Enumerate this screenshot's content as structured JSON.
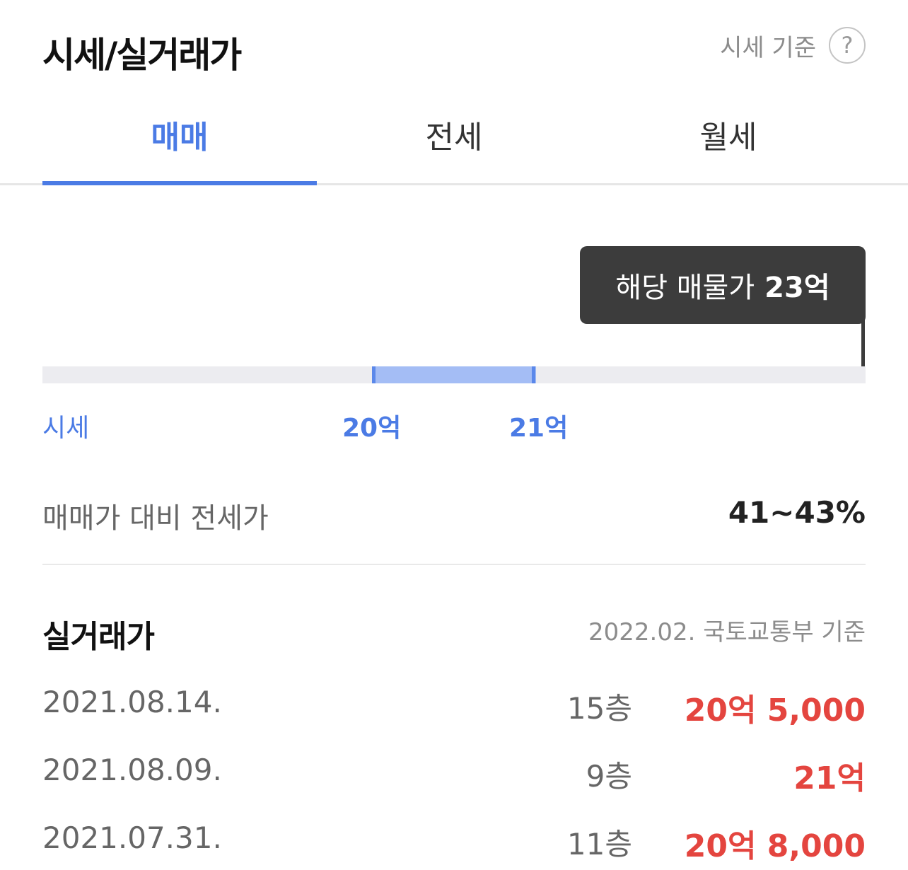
{
  "header": {
    "title": "시세/실거래가",
    "basis_label": "시세 기준",
    "help_icon": "?"
  },
  "tabs": [
    {
      "label": "매매",
      "active": true
    },
    {
      "label": "전세",
      "active": false
    },
    {
      "label": "월세",
      "active": false
    }
  ],
  "price_range": {
    "tooltip_label": "해당 매물가",
    "tooltip_value": "23억",
    "scale_label": "시세",
    "min_label": "20억",
    "max_label": "21억",
    "min": 20,
    "max": 21,
    "listing": 23,
    "unit": "억"
  },
  "ratio": {
    "label": "매매가 대비 전세가",
    "value": "41~43%"
  },
  "transactions": {
    "title": "실거래가",
    "source": "2022.02. 국토교통부 기준",
    "rows": [
      {
        "date": "2021.08.14.",
        "floor": "15층",
        "price": "20억 5,000"
      },
      {
        "date": "2021.08.09.",
        "floor": "9층",
        "price": "21억"
      },
      {
        "date": "2021.07.31.",
        "floor": "11층",
        "price": "20억 8,000"
      }
    ]
  },
  "colors": {
    "accent": "#4b7be5",
    "range_fill": "#a4bdf5",
    "price_red": "#e4453f",
    "tooltip_bg": "#3c3c3c"
  }
}
